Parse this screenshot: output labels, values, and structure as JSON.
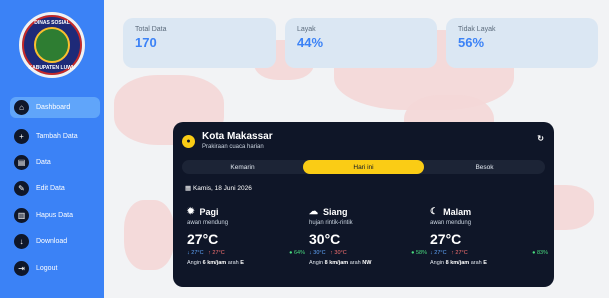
{
  "sidebar": {
    "logo_text_top": "DINAS SOSIAL",
    "logo_text_bottom": "KABUPATEN LUWU",
    "items": [
      {
        "label": "Dashboard",
        "icon": "home-icon",
        "active": true
      },
      {
        "label": "Tambah Data",
        "icon": "add-data-icon",
        "active": false
      },
      {
        "label": "Data",
        "icon": "data-icon",
        "active": false
      },
      {
        "label": "Edit Data",
        "icon": "edit-icon",
        "active": false
      },
      {
        "label": "Hapus Data",
        "icon": "trash-icon",
        "active": false
      },
      {
        "label": "Download",
        "icon": "download-icon",
        "active": false
      },
      {
        "label": "Logout",
        "icon": "logout-icon",
        "active": false
      }
    ]
  },
  "stats": [
    {
      "label": "Total Data",
      "value": "170"
    },
    {
      "label": "Layak",
      "value": "44%"
    },
    {
      "label": "Tidak Layak",
      "value": "56%"
    }
  ],
  "weather": {
    "city": "Kota Makassar",
    "subtitle": "Prakiraan cuaca harian",
    "tabs": [
      "Kemarin",
      "Hari ini",
      "Besok"
    ],
    "active_tab": "Hari ini",
    "date": "Kamis, 18 Juni 2026",
    "periods": [
      {
        "name": "Pagi",
        "icon": "sun-icon",
        "desc": "awan mendung",
        "temp": "27°C",
        "lo": "↓ 27°C",
        "hi": "↑ 27°C",
        "humidity": "64%",
        "wind_prefix": "Angin",
        "wind_speed": "6 km/jam",
        "wind_dir_prefix": "arah",
        "wind_dir": "E"
      },
      {
        "name": "Siang",
        "icon": "cloud-rain-icon",
        "desc": "hujan rintik-rintik",
        "temp": "30°C",
        "lo": "↓ 30°C",
        "hi": "↑ 30°C",
        "humidity": "58%",
        "wind_prefix": "Angin",
        "wind_speed": "8 km/jam",
        "wind_dir_prefix": "arah",
        "wind_dir": "NW"
      },
      {
        "name": "Malam",
        "icon": "moon-icon",
        "desc": "awan mendung",
        "temp": "27°C",
        "lo": "↓ 27°C",
        "hi": "↑ 27°C",
        "humidity": "83%",
        "wind_prefix": "Angin",
        "wind_speed": "8 km/jam",
        "wind_dir_prefix": "arah",
        "wind_dir": "E"
      }
    ]
  },
  "colors": {
    "sidebar": "#3b82f6",
    "accent": "#facc15",
    "panel": "#0f1628",
    "stat_value": "#3b82f6"
  }
}
